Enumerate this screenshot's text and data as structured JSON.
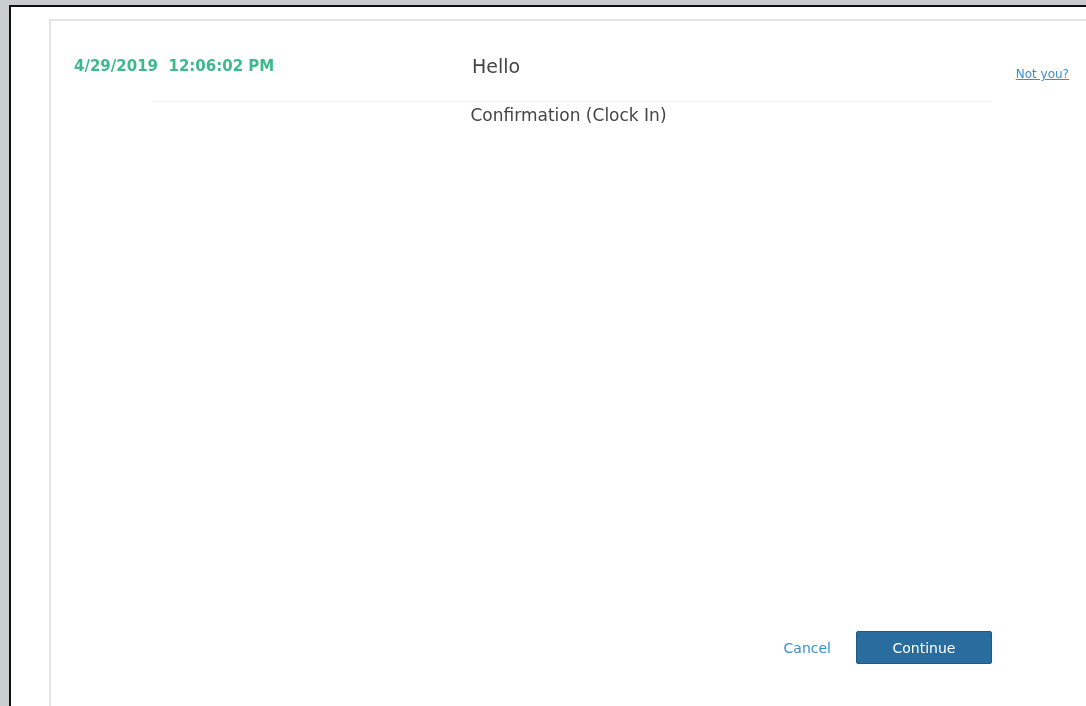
{
  "header": {
    "datetime": "4/29/2019  12:06:02 PM",
    "greeting": "Hello",
    "not_you_link": "Not you?"
  },
  "subtitle": "Confirmation (Clock In)",
  "buttons": {
    "cancel": "Cancel",
    "continue": "Continue"
  }
}
